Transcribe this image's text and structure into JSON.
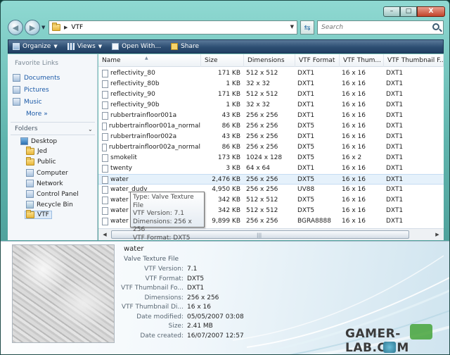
{
  "window": {
    "buttons": {
      "minimize": "–",
      "maximize": "□",
      "close": "X"
    }
  },
  "address": {
    "path": "VTF",
    "refresh_icon": "refresh-icon"
  },
  "search": {
    "placeholder": "Search"
  },
  "toolbar": {
    "organize": "Organize",
    "views": "Views",
    "open_with": "Open With...",
    "share": "Share"
  },
  "favorites": {
    "title": "Favorite Links",
    "items": [
      "Documents",
      "Pictures",
      "Music"
    ],
    "more": "More"
  },
  "folders": {
    "title": "Folders",
    "tree": [
      "Desktop",
      "Jed",
      "Public",
      "Computer",
      "Network",
      "Control Panel",
      "Recycle Bin",
      "VTF"
    ],
    "selected": "VTF"
  },
  "columns": [
    "Name",
    "Size",
    "Dimensions",
    "VTF Format",
    "VTF Thum...",
    "VTF Thumbnail F..."
  ],
  "files": [
    [
      "reflectivity_80",
      "171 KB",
      "512 x 512",
      "DXT1",
      "16 x 16",
      "DXT1"
    ],
    [
      "reflectivity_80b",
      "1 KB",
      "32 x 32",
      "DXT1",
      "16 x 16",
      "DXT1"
    ],
    [
      "reflectivity_90",
      "171 KB",
      "512 x 512",
      "DXT1",
      "16 x 16",
      "DXT1"
    ],
    [
      "reflectivity_90b",
      "1 KB",
      "32 x 32",
      "DXT1",
      "16 x 16",
      "DXT1"
    ],
    [
      "rubbertrainfloor001a",
      "43 KB",
      "256 x 256",
      "DXT1",
      "16 x 16",
      "DXT1"
    ],
    [
      "rubbertrainfloor001a_normal",
      "86 KB",
      "256 x 256",
      "DXT5",
      "16 x 16",
      "DXT1"
    ],
    [
      "rubbertrainfloor002a",
      "43 KB",
      "256 x 256",
      "DXT1",
      "16 x 16",
      "DXT1"
    ],
    [
      "rubbertrainfloor002a_normal",
      "86 KB",
      "256 x 256",
      "DXT5",
      "16 x 16",
      "DXT1"
    ],
    [
      "smokelit",
      "173 KB",
      "1024 x 128",
      "DXT5",
      "16 x 2",
      "DXT1"
    ],
    [
      "twenty",
      "3 KB",
      "64 x 64",
      "DXT1",
      "16 x 16",
      "DXT1"
    ],
    [
      "water",
      "2,476 KB",
      "256 x 256",
      "DXT5",
      "16 x 16",
      "DXT1"
    ],
    [
      "water_dudv",
      "4,950 KB",
      "256 x 256",
      "UV88",
      "16 x 16",
      "DXT1"
    ],
    [
      "water",
      "342 KB",
      "512 x 512",
      "DXT5",
      "16 x 16",
      "DXT1"
    ],
    [
      "water",
      "342 KB",
      "512 x 512",
      "DXT5",
      "16 x 16",
      "DXT1"
    ],
    [
      "water",
      "9,899 KB",
      "256 x 256",
      "BGRA8888",
      "16 x 16",
      "DXT1"
    ]
  ],
  "hovered_row": 10,
  "tooltip": [
    "Type: Valve Texture File",
    "VTF Version: 7.1",
    "Dimensions: 256 x 256",
    "VTF Format: DXT5"
  ],
  "details": {
    "name": "water",
    "type": "Valve Texture File",
    "props": [
      [
        "VTF Version:",
        "7.1"
      ],
      [
        "VTF Format:",
        "DXT5"
      ],
      [
        "VTF Thumbnail Fo...",
        "DXT1"
      ],
      [
        "Dimensions:",
        "256 x 256"
      ],
      [
        "VTF Thumbnail Di...",
        "16 x 16"
      ],
      [
        "Date modified:",
        "05/05/2007 03:08"
      ],
      [
        "Size:",
        "2.41 MB"
      ],
      [
        "Date created:",
        "16/07/2007 12:57"
      ]
    ]
  },
  "watermark": "GAMER-LAB.COM",
  "colors": {
    "toolbar": "#2d4e72",
    "link": "#1b5aa8",
    "hover_row": "#e5f1fb",
    "frame": "#5fb4ad"
  }
}
